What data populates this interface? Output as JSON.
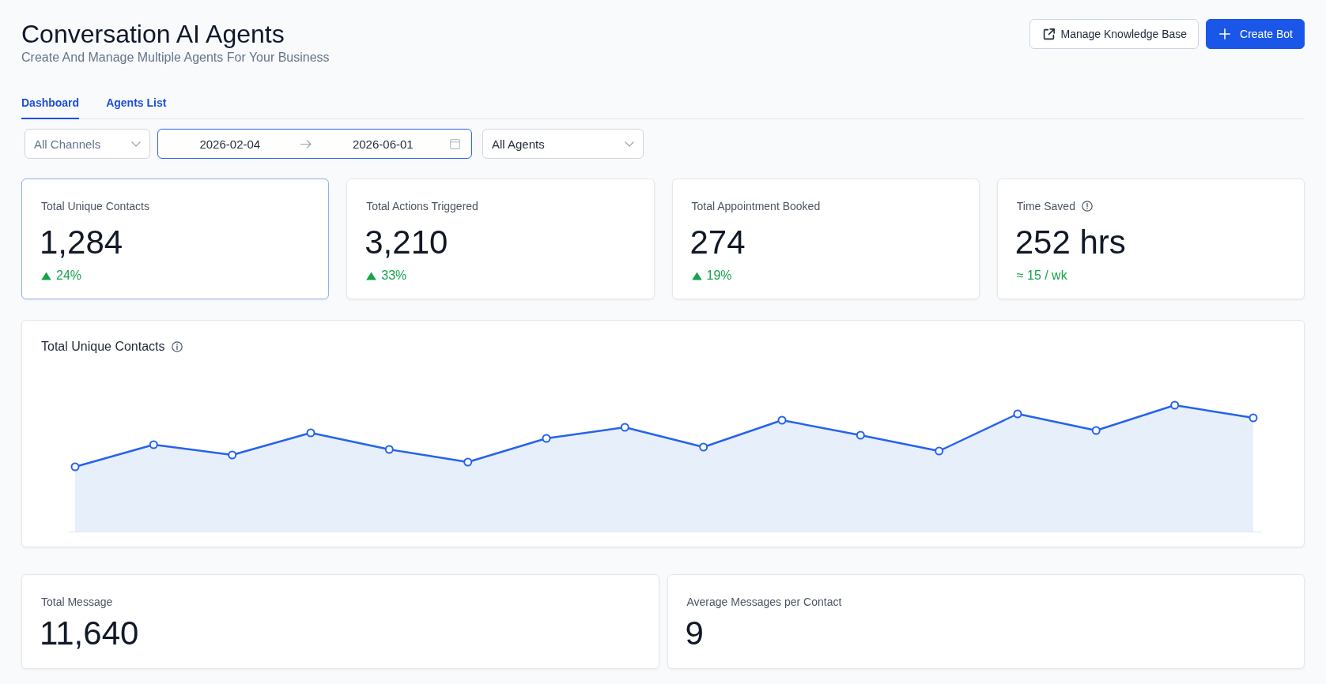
{
  "header": {
    "title": "Conversation AI Agents",
    "subtitle": "Create And Manage Multiple Agents For Your Business",
    "buttons": [
      {
        "label": "Manage Knowledge Base",
        "kind": "secondary"
      },
      {
        "label": "Create Bot",
        "kind": "primary"
      }
    ]
  },
  "tabs": [
    {
      "label": "Dashboard",
      "selected": true
    },
    {
      "label": "Agents List",
      "selected": false
    }
  ],
  "filters": {
    "channel": {
      "placeholder": "All Channels"
    },
    "date_range": {
      "start": "2026-02-04",
      "end": "2026-06-01",
      "focused": true
    },
    "agent": {
      "value": "All Agents"
    }
  },
  "stats": [
    {
      "label": "Total Unique Contacts",
      "value": "1,284",
      "up": true,
      "change": "24%",
      "selected": true
    },
    {
      "label": "Total Actions Triggered",
      "value": "3,210",
      "up": true,
      "change": "33%",
      "selected": false
    },
    {
      "label": "Total Appointment Booked",
      "value": "274",
      "up": true,
      "change": "19%",
      "selected": false
    },
    {
      "label": "Time Saved",
      "info": true,
      "value": "252 hrs",
      "note": "≈ 15 / wk",
      "selected": false
    }
  ],
  "chart": {
    "title": "Total Unique Contacts",
    "info": true
  },
  "summary": [
    {
      "label": "Total Message",
      "value": "11,640"
    },
    {
      "label": "Average Messages per Contact",
      "value": "9"
    }
  ]
}
